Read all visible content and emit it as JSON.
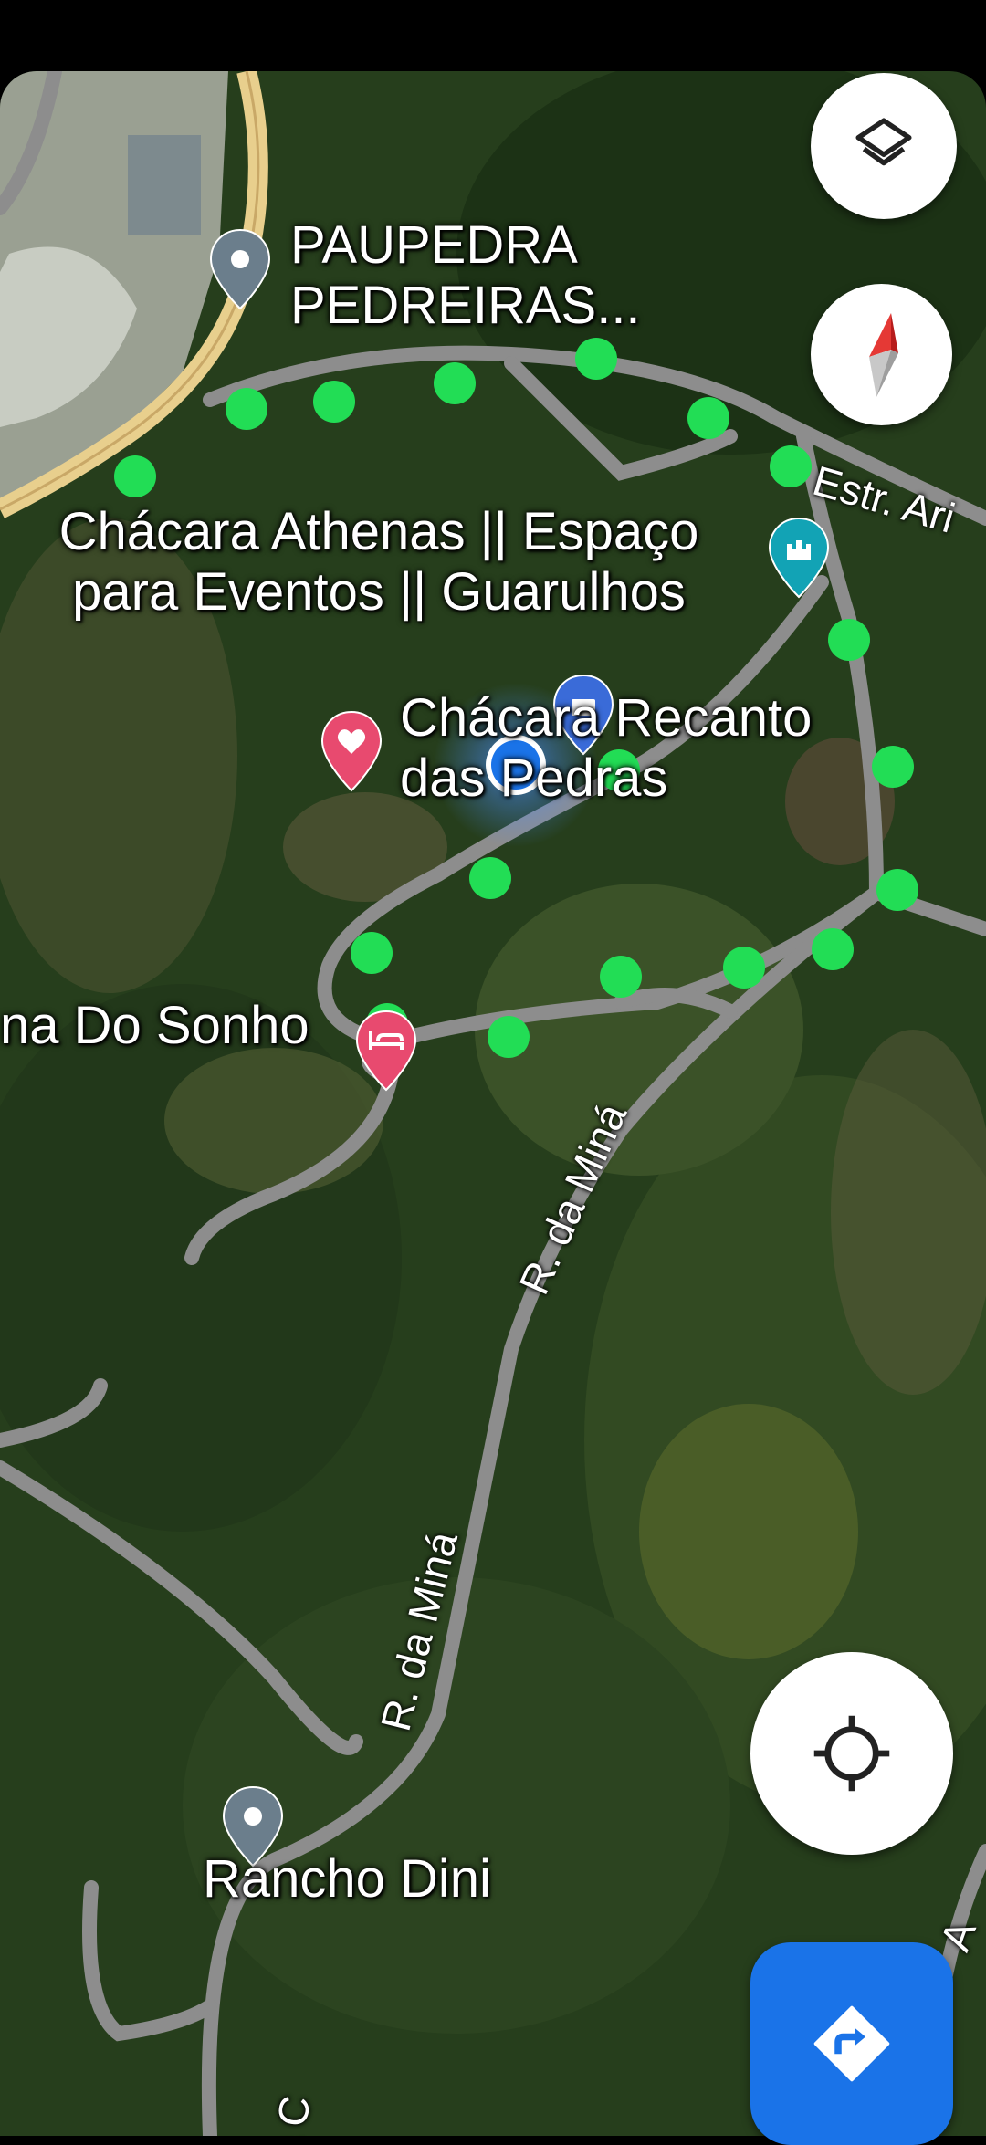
{
  "map": {
    "view": "satellite",
    "places": {
      "paupedra_line1": "PAUPEDRA",
      "paupedra_line2": "PEDREIRAS...",
      "athenas_line1": "Chácara Athenas || Espaço",
      "athenas_line2": "para Eventos || Guarulhos",
      "recanto_line1": "Chácara Recanto",
      "recanto_line2": "das Pedras",
      "sonho": "na Do Sonho",
      "rancho": "Rancho Dini"
    },
    "roads": {
      "estr": "Estr. Ari",
      "mina_upper": "R. da Miná",
      "mina_lower": "R. da Miná",
      "right_edge": "A",
      "bottom": "a C"
    },
    "route_dot_color": "#22dd55",
    "user_location_color": "#1a73e8"
  },
  "controls": {
    "layers_icon": "layers-icon",
    "compass_icon": "compass-icon",
    "my_location_icon": "crosshair-icon",
    "directions_icon": "directions-icon"
  }
}
